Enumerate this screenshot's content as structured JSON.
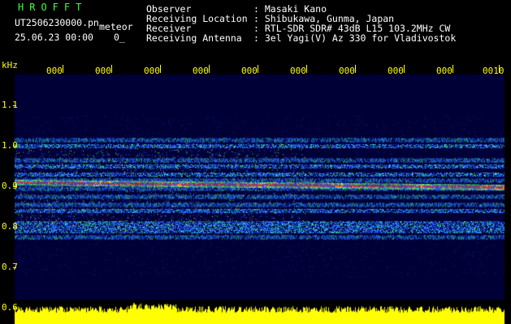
{
  "header": {
    "brand": "HROFFT",
    "filename": "UT2506230000.pn",
    "meteor_label": "meteor",
    "datetime": "25.06.23 00:00",
    "count": "0_",
    "observer_label": "Observer",
    "observer_value": ": Masaki Kano",
    "location_label": "Receiving Location",
    "location_value": ": Shibukawa, Gunma, Japan",
    "receiver_label": "Receiver",
    "receiver_value": ": RTL-SDR SDR# 43dB L15 103.2MHz CW",
    "antenna_label": "Receiving Antenna",
    "antenna_value": ": 3el Yagi(V) Az 330 for Vladivostok"
  },
  "axis": {
    "unit": "kHz",
    "y_ticks": [
      "1.1",
      "1.0",
      "0.9",
      "0.8",
      "0.7",
      "0.6"
    ],
    "time_ticks": [
      "000",
      "000",
      "000",
      "000",
      "000",
      "000",
      "000",
      "000",
      "000",
      "0010"
    ]
  },
  "colors": {
    "background": "#000036",
    "signal_hot": "#ff2020",
    "signal_warm": "#30ff50",
    "signal_cool": "#1e5cff",
    "amplitude": "#ffff00"
  },
  "spectrogram": {
    "freq_range_khz": [
      0.6,
      1.1
    ],
    "bands_khz": [
      1.015,
      1.0,
      0.965,
      0.95,
      0.93,
      0.915,
      0.895,
      0.875,
      0.855,
      0.84,
      0.81,
      0.8,
      0.79,
      0.775
    ],
    "strong_band_khz": 0.91
  }
}
